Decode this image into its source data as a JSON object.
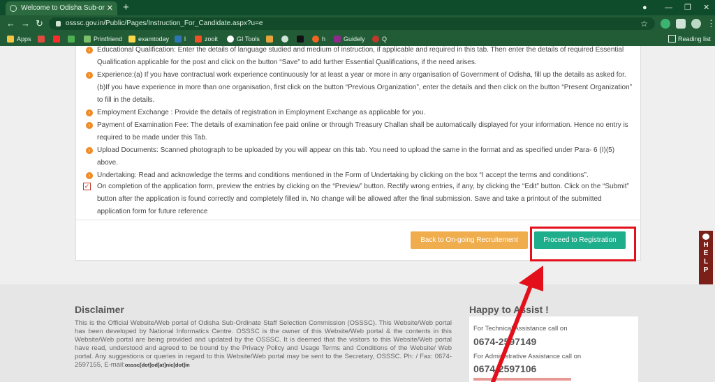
{
  "browser": {
    "tab_title": "Welcome to Odisha Sub-ordinate",
    "tab_close": "✕",
    "new_tab": "+",
    "url": "osssc.gov.in/Public/Pages/Instruction_For_Candidate.aspx?u=e",
    "bookmarks": [
      "Apps",
      "",
      "",
      "",
      "Printfriend",
      "examtoday",
      "l",
      "zooit",
      "GI Tools",
      "",
      "",
      "",
      "h",
      "Guidely",
      "Q"
    ],
    "reading_list": "Reading list"
  },
  "instructions": [
    "Educational Qualification: Enter the details of language studied and medium of instruction, if applicable and required in this tab. Then enter the details of required Essential Qualification applicable for the post and click on the button “Save” to add further Essential Qualifications, if the need arises.",
    "Experience:(a) If you have contractual work experience continuously for at least a year or more in any organisation of Government of Odisha, fill up the details as asked for. (b)If you have experience in more than one organisation, first click on the button “Previous Organization”, enter the details and then click on the button “Present Organization” to fill in the details.",
    "Employment Exchange : Provide the details of registration in Employment Exchange as applicable for you.",
    "Payment of Examination Fee: The details of examination fee paid online or through Treasury Challan shall be automatically displayed for your information. Hence no entry is required to be made under this Tab.",
    "Upload Documents: Scanned photograph to be uploaded by you will appear on this tab. You need to upload the same in the format and as specified under Para- 6 (I)(5) above.",
    "Undertaking: Read and acknowledge the terms and conditions mentioned in the Form of Undertaking by clicking on the box “I accept the terms and conditions”."
  ],
  "final_note": "On completion of the application form, preview the entries by clicking on the “Preview” button. Rectify wrong entries, if any, by clicking the “Edit” button. Click on the “Submit” button after the application is found correctly and completely filled in. No change will be allowed after the final submission. Save and take a printout of the submitted application form for future reference",
  "buttons": {
    "back": "Back to On-going Recruitement",
    "proceed": "Proceed to Registration"
  },
  "help_letters": [
    "H",
    "E",
    "L",
    "P"
  ],
  "footer": {
    "disclaimer_title": "Disclaimer",
    "disclaimer_text": "This is the Official Website/Web portal of Odisha Sub-Ordinate Staff Selection Commission (OSSSC). This Website/Web portal has been developed by National Informatics Centre. OSSSC is the owner of this Website/Web portal & the contents in this Website/Web portal are being provided and updated by the OSSSC. It is deemed that the visitors to this Website/Web portal have read, understood and agreed to be bound by the Privacy Policy and Usage Terms and Conditions of the Website/ Web portal. Any suggestions or queries in regard to this Website/Web portal may be sent to the Secretary, OSSSC. Ph: / Fax: 0674-2597155, E-mail:",
    "disclaimer_email": "osssc[dot]od[at]nic[dot]in",
    "assist_title": "Happy to Assist !",
    "tech_label": "For Technical Assistance call on",
    "tech_number": "0674-2597149",
    "admin_label": "For Administrative Assistance call on",
    "admin_number": "0674-2597106"
  },
  "colors": {
    "proceed": "#1fae8c",
    "back": "#f0ad4e",
    "highlight": "#e3101b",
    "bullet": "#f08a24"
  }
}
